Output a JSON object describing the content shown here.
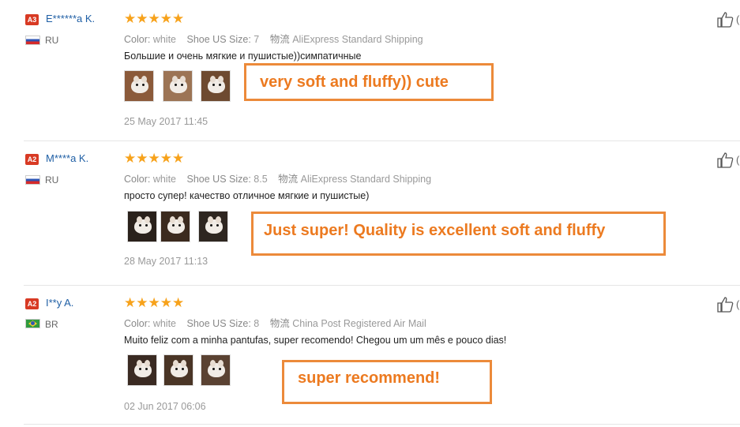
{
  "reviews": [
    {
      "badge": "A3",
      "user": "E******a K.",
      "country": "RU",
      "stars": "★★★★★",
      "color_label": "Color:",
      "color": "white",
      "size_label": "Shoe US Size:",
      "size": "7",
      "shipping_label": "物流",
      "shipping": "AliExpress Standard Shipping",
      "text": "Большие и очень мягкие и пушистые))симпатичные",
      "date": "25 May 2017 11:45",
      "annotation": "very soft and fluffy)) cute",
      "like_paren": "("
    },
    {
      "badge": "A2",
      "user": "M****a K.",
      "country": "RU",
      "stars": "★★★★★",
      "color_label": "Color:",
      "color": "white",
      "size_label": "Shoe US Size:",
      "size": "8.5",
      "shipping_label": "物流",
      "shipping": "AliExpress Standard Shipping",
      "text": "просто супер! качество отличное мягкие и пушистые)",
      "date": "28 May 2017 11:13",
      "annotation": "Just super! Quality is excellent soft and fluffy",
      "like_paren": "("
    },
    {
      "badge": "A2",
      "user": "I**y A.",
      "country": "BR",
      "stars": "★★★★★",
      "color_label": "Color:",
      "color": "white",
      "size_label": "Shoe US Size:",
      "size": "8",
      "shipping_label": "物流",
      "shipping": "China Post Registered Air Mail",
      "text": "Muito feliz com a minha pantufas, super recomendo! Chegou um um mês e pouco dias!",
      "date": "02 Jun 2017 06:06",
      "annotation": "super recommend!",
      "like_paren": "("
    }
  ],
  "colors": {
    "accent": "#ec8a3a",
    "star": "#f7a21b",
    "user_link": "#1f5fa5",
    "badge": "#d83a24"
  },
  "icons": {
    "like": "thumbs-up-icon"
  }
}
